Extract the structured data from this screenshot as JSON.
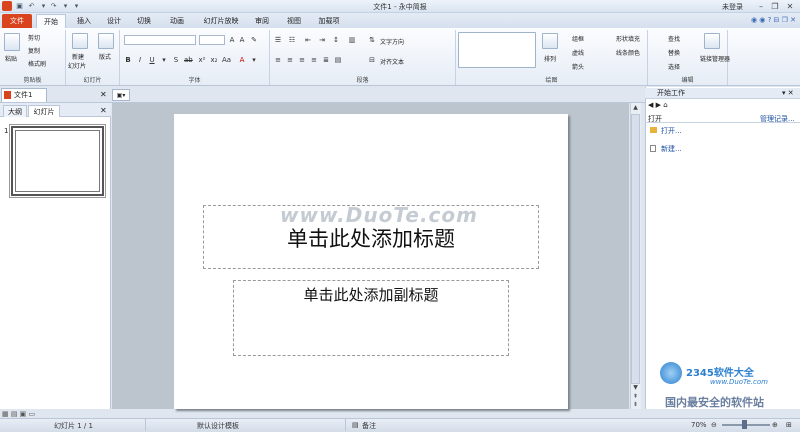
{
  "window": {
    "title": "文件1 - 永中简报",
    "login": "未登录"
  },
  "tabs": [
    "文件",
    "开始",
    "插入",
    "设计",
    "切换",
    "动画",
    "幻灯片放映",
    "审阅",
    "视图",
    "加载项"
  ],
  "ribbon": {
    "clipboard": {
      "label": "剪贴板",
      "paste": "粘贴",
      "cut": "剪切",
      "copy": "复制",
      "format_painter": "格式刷"
    },
    "slides": {
      "label": "幻灯片",
      "new_slide": "新建",
      "new_slide_2": "幻灯片",
      "layout": "版式"
    },
    "font": {
      "label": "字体",
      "font_name": "",
      "font_size": ""
    },
    "paragraph": {
      "label": "段落",
      "text_direction": "文字方向",
      "align_text": "对齐文本"
    },
    "drawing": {
      "label": "绘图",
      "arrange": "排列",
      "outline": "组框",
      "lines": "虚线",
      "arrow": "箭头",
      "shape_fill": "形状填充",
      "line_color": "线条颜色"
    },
    "editing": {
      "label": "编辑",
      "find": "查找",
      "replace": "替换",
      "select": "选择",
      "addin_manager": "链接管理器"
    }
  },
  "document_tab": "文件1",
  "left_panel": {
    "tab_outline": "大纲",
    "tab_slides": "幻灯片",
    "slide_number": "1"
  },
  "slide": {
    "title_placeholder": "单击此处添加标题",
    "subtitle_placeholder": "单击此处添加副标题",
    "watermark": "www.DuoTe.com"
  },
  "right_pane": {
    "title": "开始工作",
    "open_label": "打开",
    "manage_records": "管理记录...",
    "open_link": "打开...",
    "new_link": "新建..."
  },
  "status": {
    "slide_counter": "幻灯片 1 / 1",
    "template": "默认设计模板",
    "notes": "备注",
    "zoom": "70%"
  },
  "branding": {
    "site": "2345软件大全",
    "site_url": "www.DuoTe.com",
    "slogan": "国内最安全的软件站"
  }
}
